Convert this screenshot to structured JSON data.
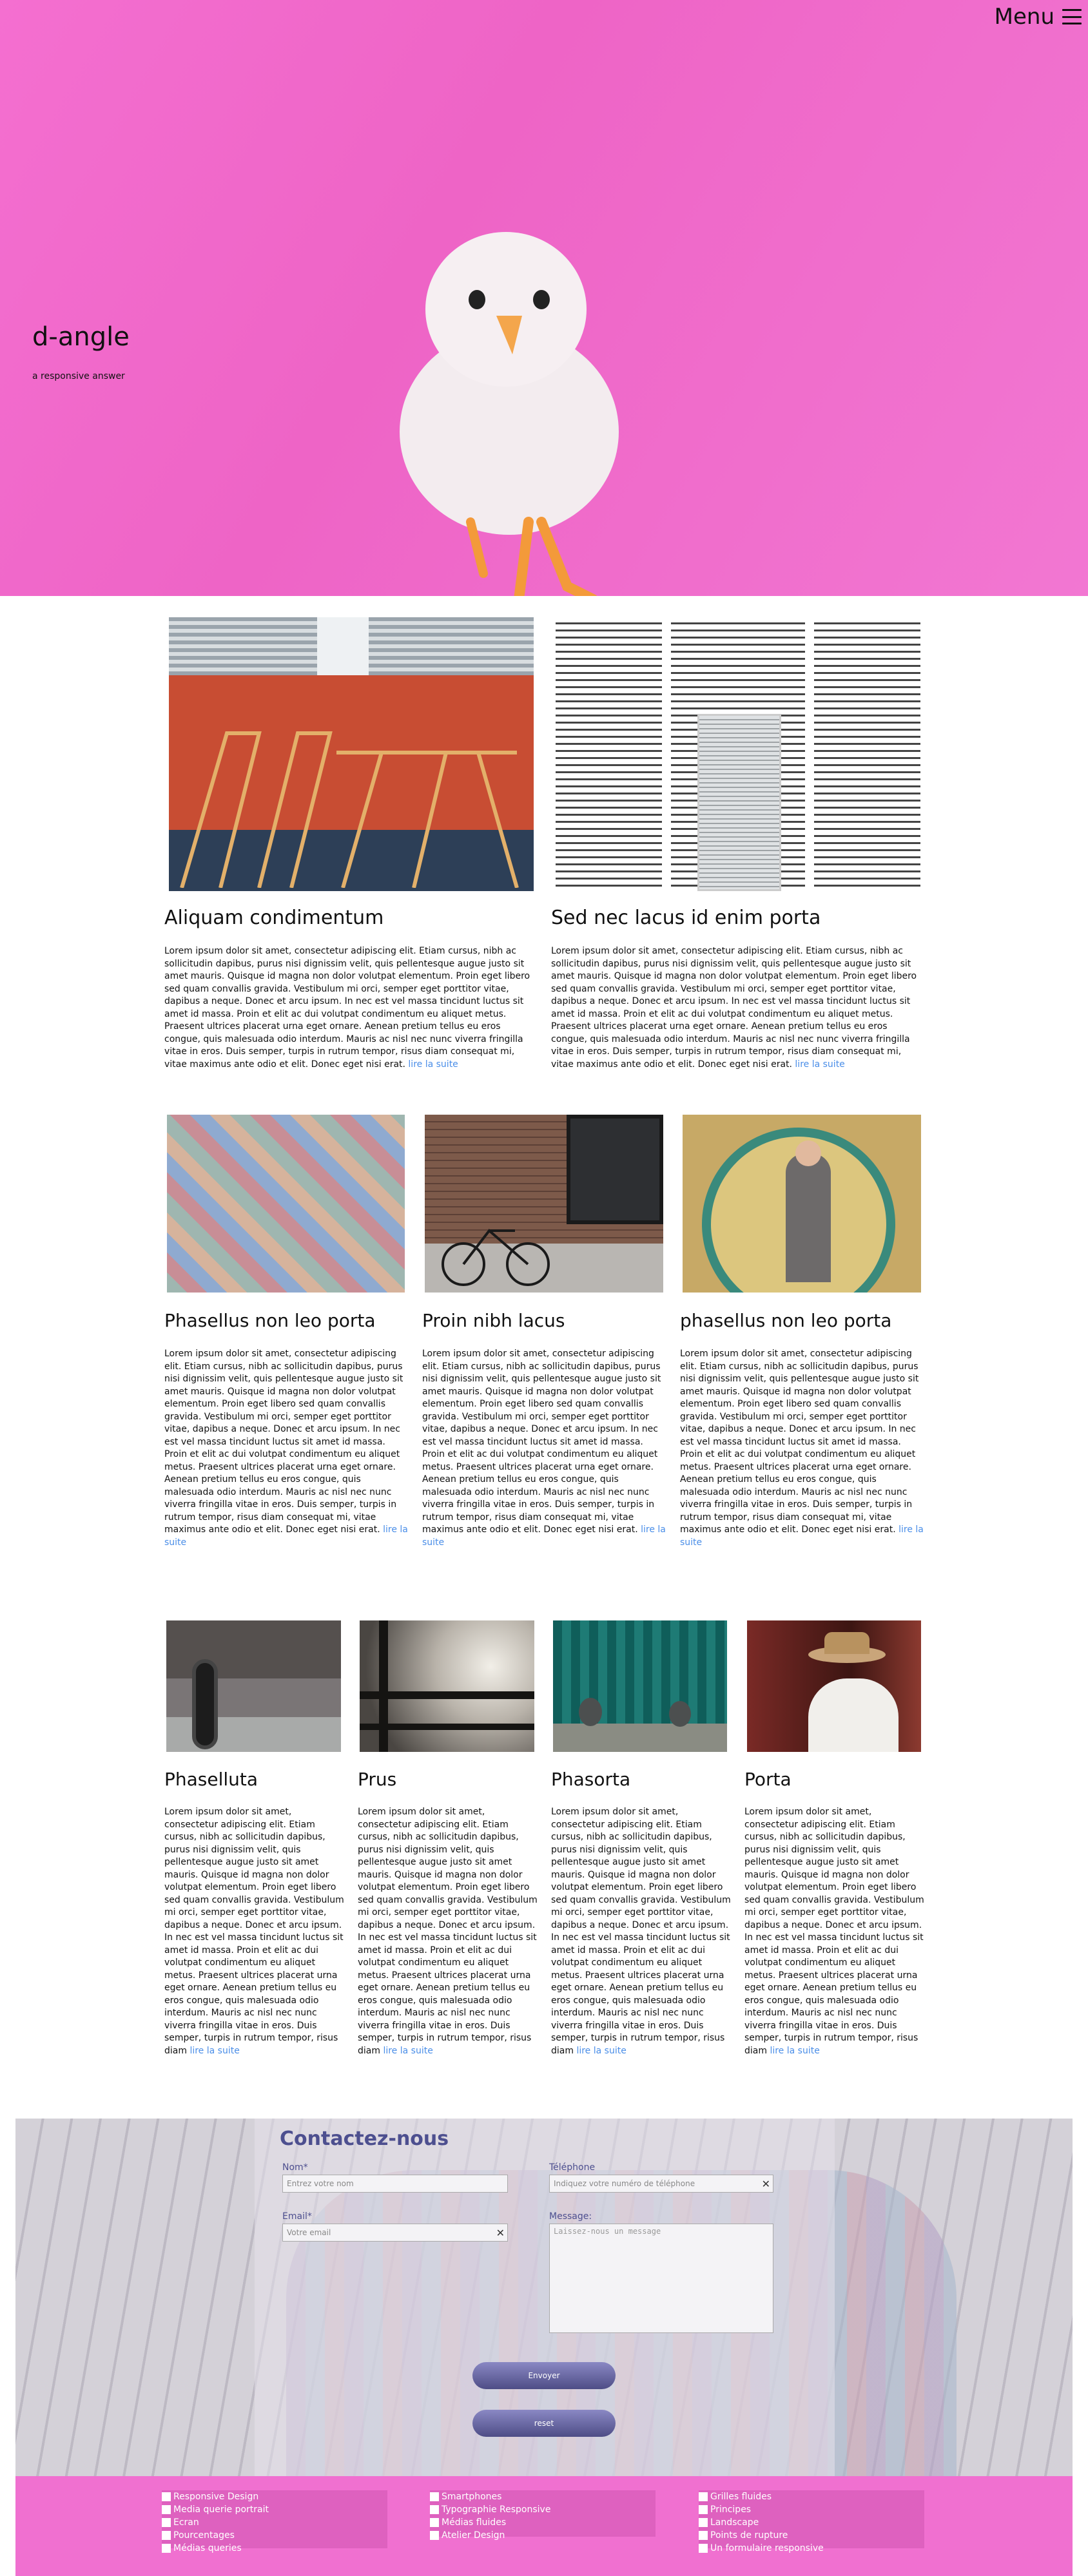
{
  "hero": {
    "menu_label": "Menu",
    "title": "d-angle",
    "subtitle": "a responsive answer"
  },
  "read_more": "lire la suite",
  "row1": [
    {
      "title": "Aliquam condimentum",
      "text": "Lorem ipsum dolor sit amet, consectetur adipiscing elit. Etiam cursus, nibh ac sollicitudin dapibus, purus nisi dignissim velit, quis pellentesque augue justo sit amet mauris. Quisque id magna non dolor volutpat elementum. Proin eget libero sed quam convallis gravida. Vestibulum mi orci, semper eget porttitor vitae, dapibus a neque. Donec et arcu ipsum. In nec est vel massa tincidunt luctus sit amet id massa. Proin et elit ac dui volutpat condimentum eu aliquet metus. Praesent ultrices placerat urna eget ornare. Aenean pretium tellus eu eros congue, quis malesuada odio interdum. Mauris ac nisl nec nunc viverra fringilla vitae in eros. Duis semper, turpis in rutrum tempor, risus diam consequat mi, vitae maximus ante odio et elit. Donec eget nisi erat."
    },
    {
      "title": "Sed nec lacus id enim porta",
      "text": "Lorem ipsum dolor sit amet, consectetur adipiscing elit. Etiam cursus, nibh ac sollicitudin dapibus, purus nisi dignissim velit, quis pellentesque augue justo sit amet mauris. Quisque id magna non dolor volutpat elementum. Proin eget libero sed quam convallis gravida. Vestibulum mi orci, semper eget porttitor vitae, dapibus a neque. Donec et arcu ipsum. In nec est vel massa tincidunt luctus sit amet id massa. Proin et elit ac dui volutpat condimentum eu aliquet metus. Praesent ultrices placerat urna eget ornare. Aenean pretium tellus eu eros congue, quis malesuada odio interdum. Mauris ac nisl nec nunc viverra fringilla vitae in eros. Duis semper, turpis in rutrum tempor, risus diam consequat mi, vitae maximus ante odio et elit. Donec eget nisi erat."
    }
  ],
  "row2": [
    {
      "title": "Phasellus non leo porta",
      "text": "Lorem ipsum dolor sit amet, consectetur adipiscing elit. Etiam cursus, nibh ac sollicitudin dapibus, purus nisi dignissim velit, quis pellentesque augue justo sit amet mauris. Quisque id magna non dolor volutpat elementum. Proin eget libero sed quam convallis gravida. Vestibulum mi orci, semper eget porttitor vitae, dapibus a neque. Donec et arcu ipsum. In nec est vel massa tincidunt luctus sit amet id massa. Proin et elit ac dui volutpat condimentum eu aliquet metus. Praesent ultrices placerat urna eget ornare. Aenean pretium tellus eu eros congue, quis malesuada odio interdum. Mauris ac nisl nec nunc viverra fringilla vitae in eros. Duis semper, turpis in rutrum tempor, risus diam consequat mi, vitae maximus ante odio et elit. Donec eget nisi erat."
    },
    {
      "title": "Proin nibh lacus",
      "text": "Lorem ipsum dolor sit amet, consectetur adipiscing elit. Etiam cursus, nibh ac sollicitudin dapibus, purus nisi dignissim velit, quis pellentesque augue justo sit amet mauris. Quisque id magna non dolor volutpat elementum. Proin eget libero sed quam convallis gravida. Vestibulum mi orci, semper eget porttitor vitae, dapibus a neque. Donec et arcu ipsum. In nec est vel massa tincidunt luctus sit amet id massa. Proin et elit ac dui volutpat condimentum eu aliquet metus. Praesent ultrices placerat urna eget ornare. Aenean pretium tellus eu eros congue, quis malesuada odio interdum. Mauris ac nisl nec nunc viverra fringilla vitae in eros. Duis semper, turpis in rutrum tempor, risus diam consequat mi, vitae maximus ante odio et elit. Donec eget nisi erat."
    },
    {
      "title": "phasellus non leo porta",
      "text": "Lorem ipsum dolor sit amet, consectetur adipiscing elit. Etiam cursus, nibh ac sollicitudin dapibus, purus nisi dignissim velit, quis pellentesque augue justo sit amet mauris. Quisque id magna non dolor volutpat elementum. Proin eget libero sed quam convallis gravida. Vestibulum mi orci, semper eget porttitor vitae, dapibus a neque. Donec et arcu ipsum. In nec est vel massa tincidunt luctus sit amet id massa. Proin et elit ac dui volutpat condimentum eu aliquet metus. Praesent ultrices placerat urna eget ornare. Aenean pretium tellus eu eros congue, quis malesuada odio interdum. Mauris ac nisl nec nunc viverra fringilla vitae in eros. Duis semper, turpis in rutrum tempor, risus diam consequat mi, vitae maximus ante odio et elit. Donec eget nisi erat."
    }
  ],
  "row3": [
    {
      "title": "Phaselluta",
      "text": "Lorem ipsum dolor sit amet, consectetur adipiscing elit. Etiam cursus, nibh ac sollicitudin dapibus, purus nisi dignissim velit, quis pellentesque augue justo sit amet mauris. Quisque id magna non dolor volutpat elementum. Proin eget libero sed quam convallis gravida. Vestibulum mi orci, semper eget porttitor vitae, dapibus a neque. Donec et arcu ipsum. In nec est vel massa tincidunt luctus sit amet id massa. Proin et elit ac dui volutpat condimentum eu aliquet metus. Praesent ultrices placerat urna eget ornare. Aenean pretium tellus eu eros congue, quis malesuada odio interdum. Mauris ac nisl nec nunc viverra fringilla vitae in eros. Duis semper, turpis in rutrum tempor, risus diam"
    },
    {
      "title": "Prus",
      "text": "Lorem ipsum dolor sit amet, consectetur adipiscing elit. Etiam cursus, nibh ac sollicitudin dapibus, purus nisi dignissim velit, quis pellentesque augue justo sit amet mauris. Quisque id magna non dolor volutpat elementum. Proin eget libero sed quam convallis gravida. Vestibulum mi orci, semper eget porttitor vitae, dapibus a neque. Donec et arcu ipsum. In nec est vel massa tincidunt luctus sit amet id massa. Proin et elit ac dui volutpat condimentum eu aliquet metus. Praesent ultrices placerat urna eget ornare. Aenean pretium tellus eu eros congue, quis malesuada odio interdum. Mauris ac nisl nec nunc viverra fringilla vitae in eros. Duis semper, turpis in rutrum tempor, risus diam"
    },
    {
      "title": "Phasorta",
      "text": "Lorem ipsum dolor sit amet, consectetur adipiscing elit. Etiam cursus, nibh ac sollicitudin dapibus, purus nisi dignissim velit, quis pellentesque augue justo sit amet mauris. Quisque id magna non dolor volutpat elementum. Proin eget libero sed quam convallis gravida. Vestibulum mi orci, semper eget porttitor vitae, dapibus a neque. Donec et arcu ipsum. In nec est vel massa tincidunt luctus sit amet id massa. Proin et elit ac dui volutpat condimentum eu aliquet metus. Praesent ultrices placerat urna eget ornare. Aenean pretium tellus eu eros congue, quis malesuada odio interdum. Mauris ac nisl nec nunc viverra fringilla vitae in eros. Duis semper, turpis in rutrum tempor, risus diam"
    },
    {
      "title": "Porta",
      "text": "Lorem ipsum dolor sit amet, consectetur adipiscing elit. Etiam cursus, nibh ac sollicitudin dapibus, purus nisi dignissim velit, quis pellentesque augue justo sit amet mauris. Quisque id magna non dolor volutpat elementum. Proin eget libero sed quam convallis gravida. Vestibulum mi orci, semper eget porttitor vitae, dapibus a neque. Donec et arcu ipsum. In nec est vel massa tincidunt luctus sit amet id massa. Proin et elit ac dui volutpat condimentum eu aliquet metus. Praesent ultrices placerat urna eget ornare. Aenean pretium tellus eu eros congue, quis malesuada odio interdum. Mauris ac nisl nec nunc viverra fringilla vitae in eros. Duis semper, turpis in rutrum tempor, risus diam"
    }
  ],
  "contact": {
    "title": "Contactez-nous",
    "name_label": "Nom*",
    "name_placeholder": "Entrez votre nom",
    "email_label": "Email*",
    "email_placeholder": "Votre email",
    "phone_label": "Téléphone",
    "phone_placeholder": "Indiquez votre numéro de téléphone",
    "message_label": "Message:",
    "message_placeholder": "Laissez-nous un message",
    "clear_glyph": "✕",
    "send_label": "Envoyer",
    "reset_label": "reset"
  },
  "footer": {
    "col1": [
      "Responsive Design",
      "Media querie portrait",
      "Ecran",
      "Pourcentages",
      "Médias queries"
    ],
    "col2": [
      "Smartphones",
      "Typographie Responsive",
      "Médias fluides",
      "Atelier Design"
    ],
    "col3": [
      "Grilles fluides",
      "Principes",
      "Landscape",
      "Points de rupture",
      "Un formulaire responsive"
    ]
  },
  "colors": {
    "hero_pink": "#ee64c6",
    "accent_purple": "#4d4f8f",
    "link_blue": "#4a8ee8",
    "footer_pink": "#f070d0"
  }
}
